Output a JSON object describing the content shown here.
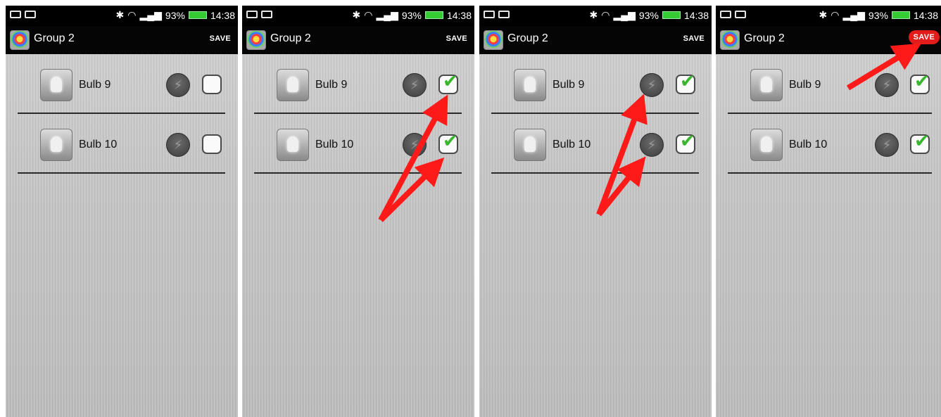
{
  "status_bar": {
    "battery": "93%",
    "time": "14:38"
  },
  "action_bar": {
    "title": "Group 2",
    "save_label": "SAVE"
  },
  "bulbs": [
    {
      "name": "Bulb 9"
    },
    {
      "name": "Bulb 10"
    }
  ],
  "panels": [
    {
      "step": 1,
      "bulb9_checked": false,
      "bulb10_checked": false,
      "save_highlighted": false
    },
    {
      "step": 2,
      "bulb9_checked": true,
      "bulb10_checked": true,
      "save_highlighted": false
    },
    {
      "step": 3,
      "bulb9_checked": true,
      "bulb10_checked": true,
      "save_highlighted": false
    },
    {
      "step": 4,
      "bulb9_checked": true,
      "bulb10_checked": true,
      "save_highlighted": true
    }
  ],
  "icons": {
    "app": "app-logo-icon",
    "bulb": "light-bulb-icon",
    "flash": "lightning-bolt-icon",
    "checkbox": "checkbox-icon",
    "bluetooth": "bluetooth-icon",
    "wifi": "wifi-icon",
    "signal": "signal-icon",
    "battery": "battery-icon"
  },
  "colors": {
    "annotation_arrow": "#ff1a1a",
    "check_mark": "#39b62e",
    "save_highlight": "#e21b1b"
  }
}
